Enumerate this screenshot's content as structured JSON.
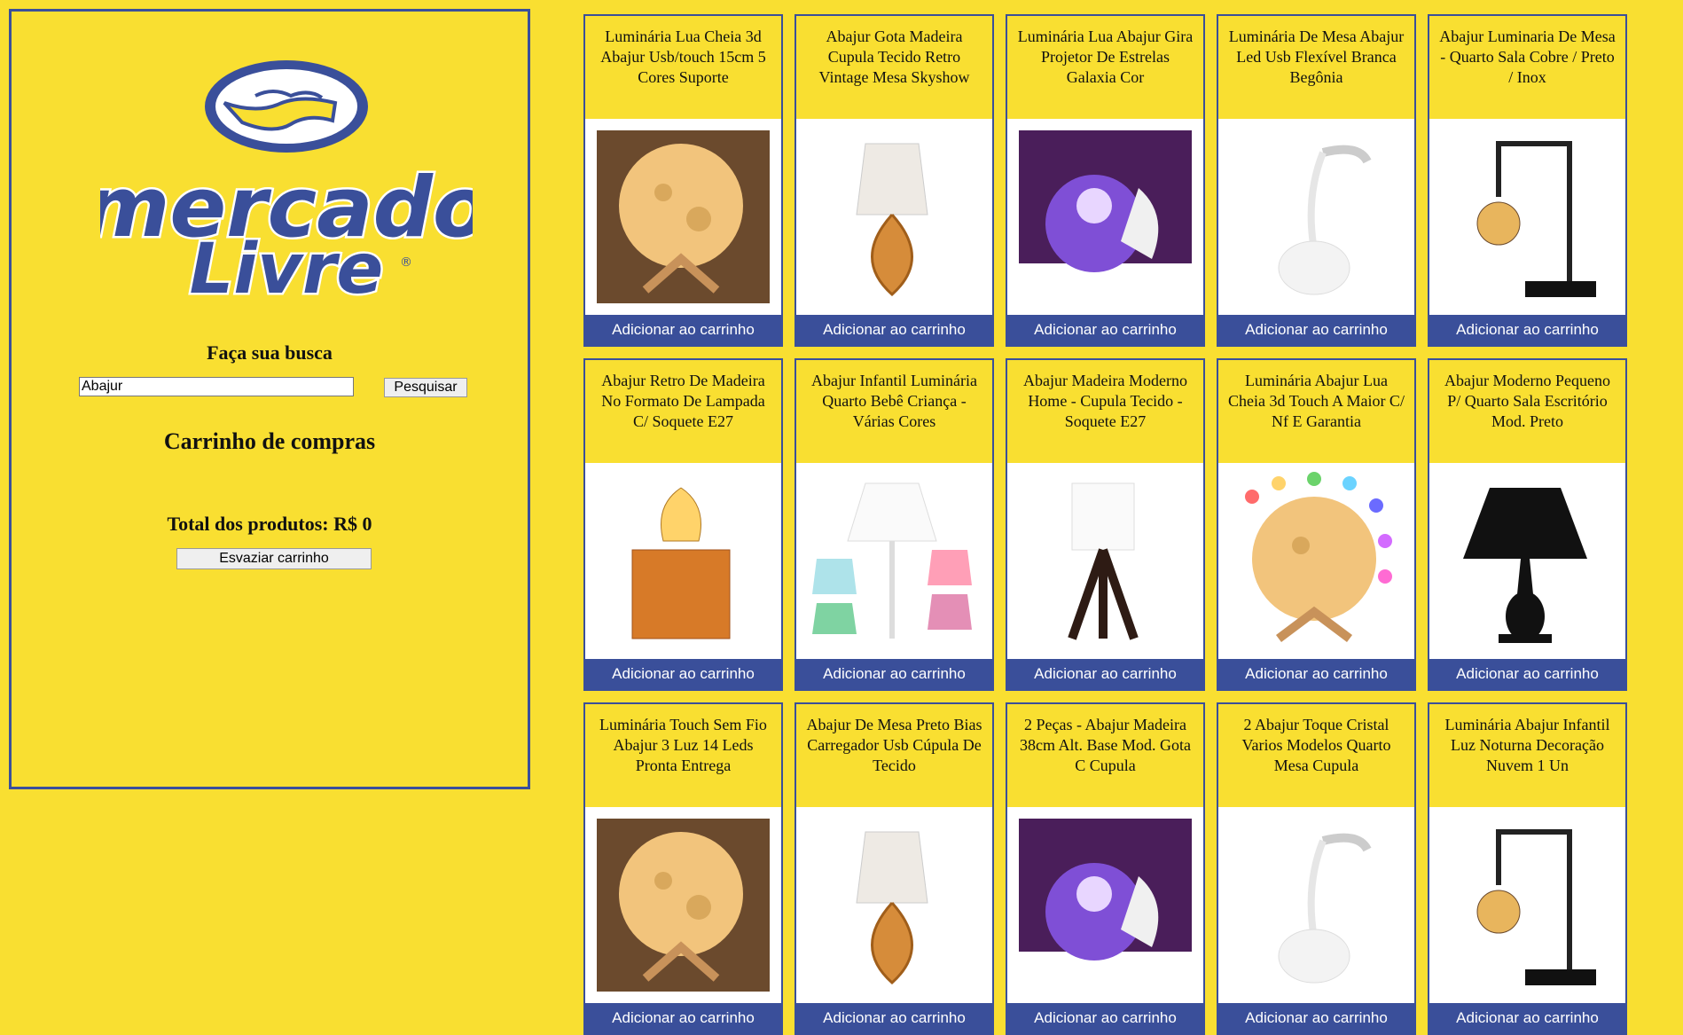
{
  "logo": {
    "line1": "mercado",
    "line2": "Livre",
    "mark": "®"
  },
  "search": {
    "title": "Faça sua busca",
    "value": "Abajur",
    "button_label": "Pesquisar"
  },
  "cart": {
    "title": "Carrinho de compras",
    "total_label": "Total dos produtos: R$ 0",
    "clear_label": "Esvaziar carrinho"
  },
  "colors": {
    "background": "#f9df31",
    "accent": "#3a4f9a",
    "button_text": "#ffffff"
  },
  "products": [
    {
      "title": "Luminária Lua Cheia 3d Abajur Usb/touch 15cm 5 Cores Suporte",
      "button": "Adicionar ao carrinho",
      "icon": "moon-lamp-image"
    },
    {
      "title": "Abajur Gota Madeira Cupula Tecido Retro Vintage Mesa Skyshow",
      "button": "Adicionar ao carrinho",
      "icon": "wood-drop-lamp-image"
    },
    {
      "title": "Luminária Lua Abajur Gira Projetor De Estrelas Galaxia Cor",
      "button": "Adicionar ao carrinho",
      "icon": "star-projector-image"
    },
    {
      "title": "Luminária De Mesa Abajur Led Usb Flexível Branca Begônia",
      "button": "Adicionar ao carrinho",
      "icon": "led-desk-lamp-image"
    },
    {
      "title": "Abajur Luminaria De Mesa - Quarto Sala Cobre / Preto / Inox",
      "button": "Adicionar ao carrinho",
      "icon": "industrial-lamp-image"
    },
    {
      "title": "Abajur Retro De Madeira No Formato De Lampada C/ Soquete E27",
      "button": "Adicionar ao carrinho",
      "icon": "wood-bulb-lamp-image"
    },
    {
      "title": "Abajur Infantil Luminária Quarto Bebê Criança - Várias Cores",
      "button": "Adicionar ao carrinho",
      "icon": "kids-lamp-image"
    },
    {
      "title": "Abajur Madeira Moderno Home - Cupula Tecido - Soquete E27",
      "button": "Adicionar ao carrinho",
      "icon": "modern-wood-lamp-image"
    },
    {
      "title": "Luminária Abajur Lua Cheia 3d Touch A Maior C/ Nf E Garantia",
      "button": "Adicionar ao carrinho",
      "icon": "moon-lamp-colors-image"
    },
    {
      "title": "Abajur Moderno Pequeno P/ Quarto Sala Escritório Mod. Preto",
      "button": "Adicionar ao carrinho",
      "icon": "black-lamp-image"
    },
    {
      "title": "Luminária Touch Sem Fio Abajur 3 Luz 14 Leds Pronta Entrega",
      "button": "Adicionar ao carrinho",
      "icon": "touch-lamp-image"
    },
    {
      "title": "Abajur De Mesa Preto Bias Carregador Usb Cúpula De Tecido",
      "button": "Adicionar ao carrinho",
      "icon": "black-usb-lamp-image"
    },
    {
      "title": "2 Peças - Abajur Madeira 38cm Alt. Base Mod. Gota C Cupula",
      "button": "Adicionar ao carrinho",
      "icon": "wood-pair-lamp-image"
    },
    {
      "title": "2 Abajur Toque Cristal Varios Modelos Quarto Mesa Cupula",
      "button": "Adicionar ao carrinho",
      "icon": "crystal-lamp-image"
    },
    {
      "title": "Luminária Abajur Infantil Luz Noturna Decoração Nuvem 1 Un",
      "button": "Adicionar ao carrinho",
      "icon": "cloud-lamp-image"
    }
  ]
}
